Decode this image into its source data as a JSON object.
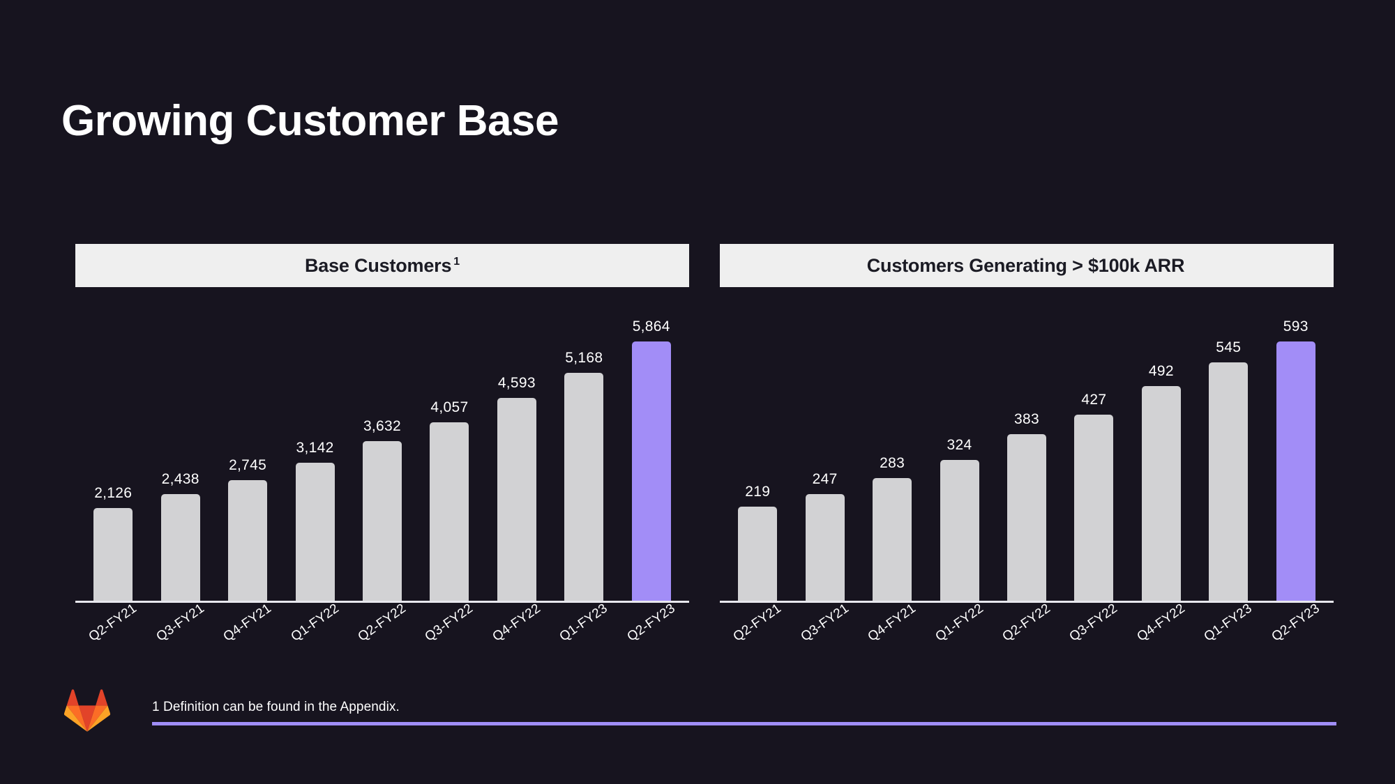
{
  "slide": {
    "title": "Growing Customer Base",
    "background_color": "#17141f",
    "accent_color": "#a28df7",
    "bar_color": "#d2d2d4",
    "banner_color": "#efefef"
  },
  "footer": {
    "logo_icon": "gitlab-tanuki-logo",
    "footnote": "1 Definition can be found in the Appendix.",
    "rule_color": "#a08ef8"
  },
  "chart_data": [
    {
      "type": "bar",
      "title": "Base Customers",
      "title_superscript": "1",
      "xlabel": "",
      "ylabel": "",
      "grid": false,
      "legend": "none",
      "categories": [
        "Q2-FY21",
        "Q3-FY21",
        "Q4-FY21",
        "Q1-FY22",
        "Q2-FY22",
        "Q3-FY22",
        "Q4-FY22",
        "Q1-FY23",
        "Q2-FY23"
      ],
      "values": [
        2126,
        2438,
        2745,
        3142,
        3632,
        4057,
        4593,
        5168,
        5864
      ],
      "value_labels": [
        "2,126",
        "2,438",
        "2,745",
        "3,142",
        "3,632",
        "4,057",
        "4,593",
        "5,168",
        "5,864"
      ],
      "highlight_index": 8,
      "ylim": [
        0,
        5864
      ]
    },
    {
      "type": "bar",
      "title": "Customers Generating > $100k ARR",
      "title_superscript": "",
      "xlabel": "",
      "ylabel": "",
      "grid": false,
      "legend": "none",
      "categories": [
        "Q2-FY21",
        "Q3-FY21",
        "Q4-FY21",
        "Q1-FY22",
        "Q2-FY22",
        "Q3-FY22",
        "Q4-FY22",
        "Q1-FY23",
        "Q2-FY23"
      ],
      "values": [
        219,
        247,
        283,
        324,
        383,
        427,
        492,
        545,
        593
      ],
      "value_labels": [
        "219",
        "247",
        "283",
        "324",
        "383",
        "427",
        "492",
        "545",
        "593"
      ],
      "highlight_index": 8,
      "ylim": [
        0,
        593
      ]
    }
  ]
}
